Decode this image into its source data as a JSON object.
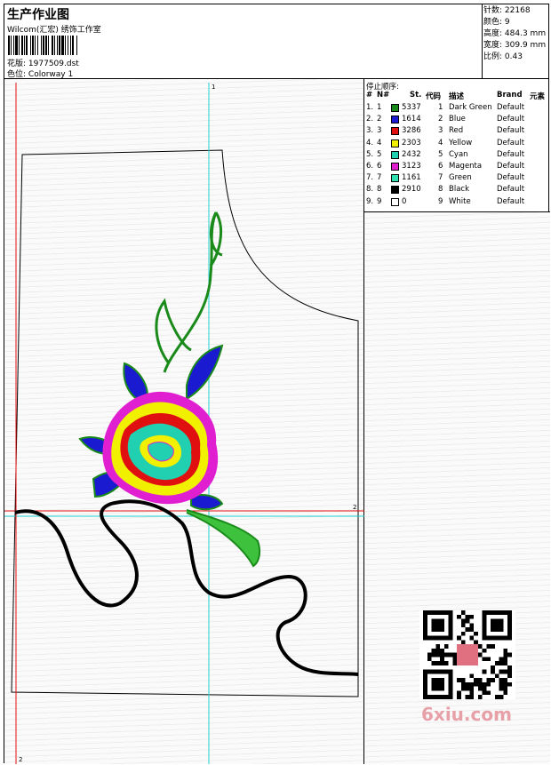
{
  "header": {
    "title": "生产作业图",
    "subtitle": "Wilcom(汇宏) 绣饰工作室",
    "design_label": "花版:",
    "design_value": "1977509.dst",
    "colorway_label": "色位:",
    "colorway_value": "Colorway 1"
  },
  "stats": {
    "stitches_label": "针数:",
    "stitches_value": "22168",
    "colors_label": "颜色:",
    "colors_value": "9",
    "height_label": "高度:",
    "height_value": "484.3 mm",
    "width_label": "宽度:",
    "width_value": "309.9 mm",
    "scale_label": "比例:",
    "scale_value": "0.43"
  },
  "legend": {
    "title": "停止顺序:",
    "headers": {
      "num": "#",
      "n": "N#",
      "st": "St.",
      "code": "代码",
      "desc": "描述",
      "brand": "Brand",
      "elem": "元素"
    },
    "rows": [
      {
        "num": "1.",
        "n": "1",
        "color": "#1a8a1a",
        "st": "5337",
        "code": "1",
        "desc": "Dark Green",
        "brand": "Default"
      },
      {
        "num": "2.",
        "n": "2",
        "color": "#1a1ad0",
        "st": "1614",
        "code": "2",
        "desc": "Blue",
        "brand": "Default"
      },
      {
        "num": "3.",
        "n": "3",
        "color": "#e01010",
        "st": "3286",
        "code": "3",
        "desc": "Red",
        "brand": "Default"
      },
      {
        "num": "4.",
        "n": "4",
        "color": "#f0f000",
        "st": "2303",
        "code": "4",
        "desc": "Yellow",
        "brand": "Default"
      },
      {
        "num": "5.",
        "n": "5",
        "color": "#20d0b0",
        "st": "2432",
        "code": "5",
        "desc": "Cyan",
        "brand": "Default"
      },
      {
        "num": "6.",
        "n": "6",
        "color": "#e020d0",
        "st": "3123",
        "code": "6",
        "desc": "Magenta",
        "brand": "Default"
      },
      {
        "num": "7.",
        "n": "7",
        "color": "#30e0b0",
        "st": "1161",
        "code": "7",
        "desc": "Green",
        "brand": "Default"
      },
      {
        "num": "8.",
        "n": "8",
        "color": "#000000",
        "st": "2910",
        "code": "8",
        "desc": "Black",
        "brand": "Default"
      },
      {
        "num": "9.",
        "n": "9",
        "color": "#ffffff",
        "st": "0",
        "code": "9",
        "desc": "White",
        "brand": "Default"
      }
    ]
  },
  "markers": {
    "top": "1",
    "right": "2",
    "bottom": "2"
  },
  "watermark": "6xiu.com",
  "colors": {
    "guide_cyan": "#20d0d0",
    "guide_red": "#e01010"
  }
}
